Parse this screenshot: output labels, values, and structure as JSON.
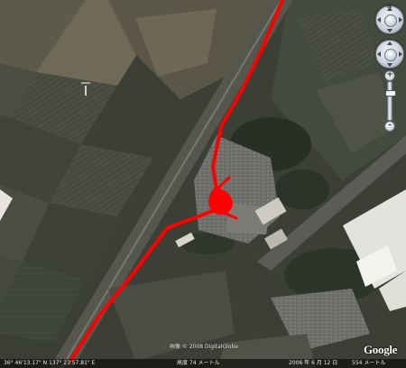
{
  "map": {
    "imagery_type": "satellite",
    "route_color": "#ff0000",
    "copyright": "画像 © 2008 DigitalGlobe",
    "logo": "Google"
  },
  "status": {
    "coords": "36° 46'13.17\" N  137° 23'57.81\" E",
    "altitude": "高度  74 メートル",
    "date": "2006 年 6 月 12 日",
    "eye_alt": "554 メートル"
  },
  "nav_control": {
    "north_label": "N",
    "zoom_in": "+",
    "zoom_out": "-",
    "zoom_level": 0.75
  }
}
